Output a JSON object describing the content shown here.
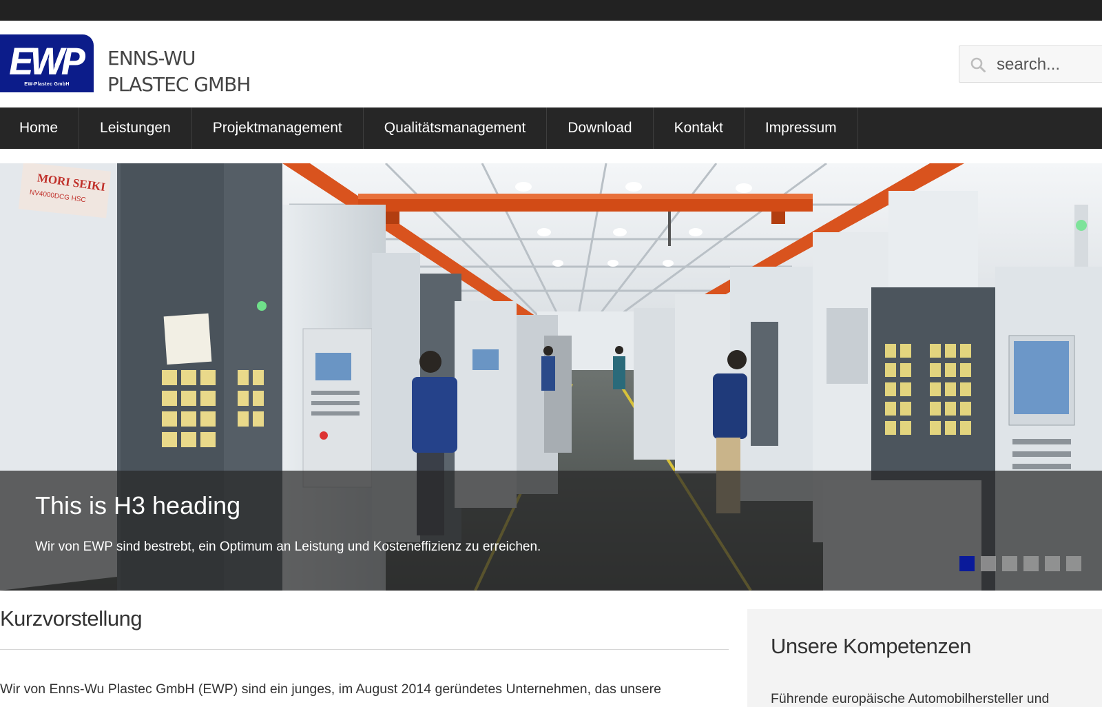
{
  "header": {
    "logo_text": "EWP",
    "logo_subtext": "EW-Plastec GmbH",
    "company_line1": "ENNS-WU",
    "company_line2": "PLASTEC GMBH",
    "search_placeholder": "search..."
  },
  "nav": {
    "items": [
      {
        "label": "Home"
      },
      {
        "label": "Leistungen"
      },
      {
        "label": "Projektmanagement"
      },
      {
        "label": "Qualitätsmanagement"
      },
      {
        "label": "Download"
      },
      {
        "label": "Kontakt"
      },
      {
        "label": "Impressum"
      }
    ]
  },
  "slider": {
    "heading": "This is H3 heading",
    "text": "Wir von EWP sind bestrebt, ein Optimum an Leistung und Kosteneffizienz zu erreichen.",
    "slide_count": 6,
    "active_slide": 1,
    "machine_brand": "MORI SEIKI",
    "machine_model": "NV4000DCG HSC"
  },
  "main": {
    "title": "Kurzvorstellung",
    "intro": "Wir von Enns-Wu Plastec GmbH (EWP) sind ein junges, im August 2014 geründetes Unternehmen, das unsere"
  },
  "sidebar": {
    "title": "Unsere Kompetenzen",
    "text": "Führende europäische Automobilhersteller und"
  },
  "colors": {
    "topbar": "#222222",
    "nav_bg": "#262626",
    "brand_blue": "#0c1c8a",
    "active_dot": "#0a1a9a"
  }
}
